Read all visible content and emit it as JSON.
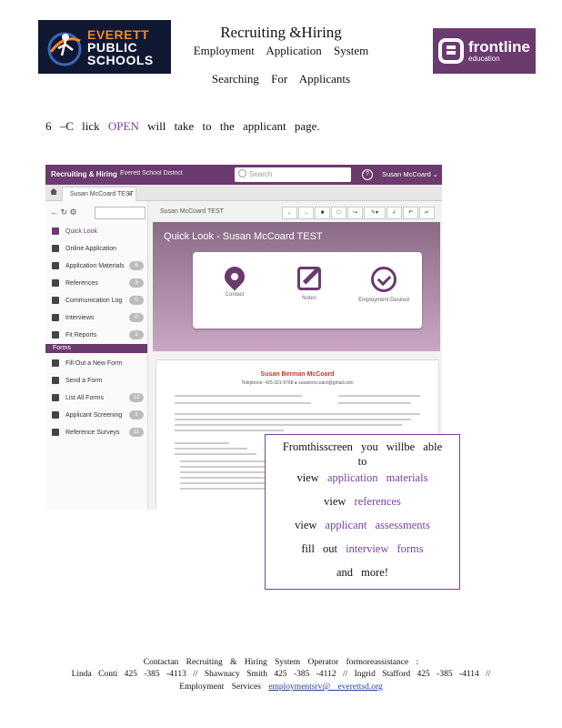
{
  "header": {
    "eps_logo": [
      "EVERETT",
      "PUBLIC",
      "SCHOOLS"
    ],
    "title": "Recruiting &Hiring",
    "subtitle": "Employment Application System",
    "section": "Searching For Applicants",
    "frontline_logo": {
      "name": "frontline",
      "tag": "education"
    }
  },
  "step": {
    "prefix": "6 –C lick ",
    "link": "OPEN",
    "suffix": " will take to the applicant page."
  },
  "app": {
    "brand": "Recruiting & Hiring",
    "district": "Everett School District",
    "search_placeholder": "Search",
    "help": "?",
    "user": "Susan McCoard ⌄",
    "tab_label": "Susan McCoard TEST",
    "tab_close": "×",
    "sidebar": {
      "items": [
        {
          "label": "Quick Look",
          "badge": ""
        },
        {
          "label": "Online Application",
          "badge": ""
        },
        {
          "label": "Application Materials",
          "badge": "6"
        },
        {
          "label": "References",
          "badge": "3"
        },
        {
          "label": "Communication Log",
          "badge": "0"
        },
        {
          "label": "Interviews",
          "badge": "0"
        },
        {
          "label": "Fit Reports",
          "badge": "2"
        }
      ],
      "forms_header": "Forms",
      "forms": [
        {
          "label": "Fill Out a New Form",
          "badge": ""
        },
        {
          "label": "Send a Form",
          "badge": ""
        },
        {
          "label": "List All Forms",
          "badge": "12"
        },
        {
          "label": "Applicant Screening",
          "badge": "1"
        },
        {
          "label": "Reference Surveys",
          "badge": "11"
        }
      ],
      "logo": "frontline"
    },
    "main": {
      "name": "Susan McCoard TEST",
      "quick_look_title": "Quick Look - Susan McCoard TEST",
      "icons": [
        "Contact",
        "Notes",
        "Employment Desired"
      ],
      "doc_name": "Susan Berman McCoard",
      "doc_contact": "Telephone: 425-321-9768 ● susanmccoard@gmail.com"
    }
  },
  "callout": {
    "line1": "Fromthisscreen you willbe able",
    "line2": "to",
    "view": "view",
    "app_materials": "application materials",
    "references": "references",
    "assessments": "applicant assessments",
    "fill_out": "fill out",
    "interview_forms": "interview forms",
    "more": "and more!"
  },
  "footer": {
    "line1": "Contactan Recruiting & Hiring System Operator formoreassistance :",
    "line2": "Linda Conti 425 -385 -4113 // Shawnacy Smith 425 -385 -4112 // Ingrid Stafford 425 -385 -4114 //",
    "line3_prefix": "Employment Services ",
    "email": "employmentsrv@ everettsd.org"
  }
}
